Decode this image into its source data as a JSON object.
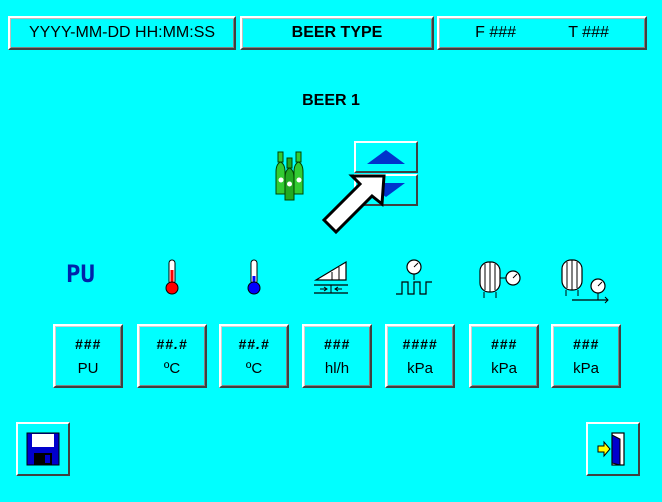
{
  "header": {
    "datetime": "YYYY-MM-DD HH:MM:SS",
    "title": "BEER TYPE",
    "f_value": "F ###",
    "t_value": "T ###"
  },
  "main": {
    "beer_name": "BEER 1"
  },
  "parameters": [
    {
      "icon_text": "PU",
      "value": "###",
      "unit": "PU"
    },
    {
      "value": "##.#",
      "unit": "ºC"
    },
    {
      "value": "##.#",
      "unit": "ºC"
    },
    {
      "value": "###",
      "unit": "hl/h"
    },
    {
      "value": "####",
      "unit": "kPa"
    },
    {
      "value": "###",
      "unit": "kPa"
    },
    {
      "value": "###",
      "unit": "kPa"
    }
  ],
  "colors": {
    "background": "#00FFFF",
    "arrow": "#0033CC",
    "pu_icon": "#0022AA",
    "thermo_red": "#FF0000",
    "thermo_blue": "#0000FF",
    "bottle_green": "#33CC33"
  },
  "icons": {
    "beer": "bottles-icon",
    "up": "arrow-up-icon",
    "down": "arrow-down-icon",
    "save": "floppy-disk-icon",
    "exit": "exit-door-icon"
  }
}
